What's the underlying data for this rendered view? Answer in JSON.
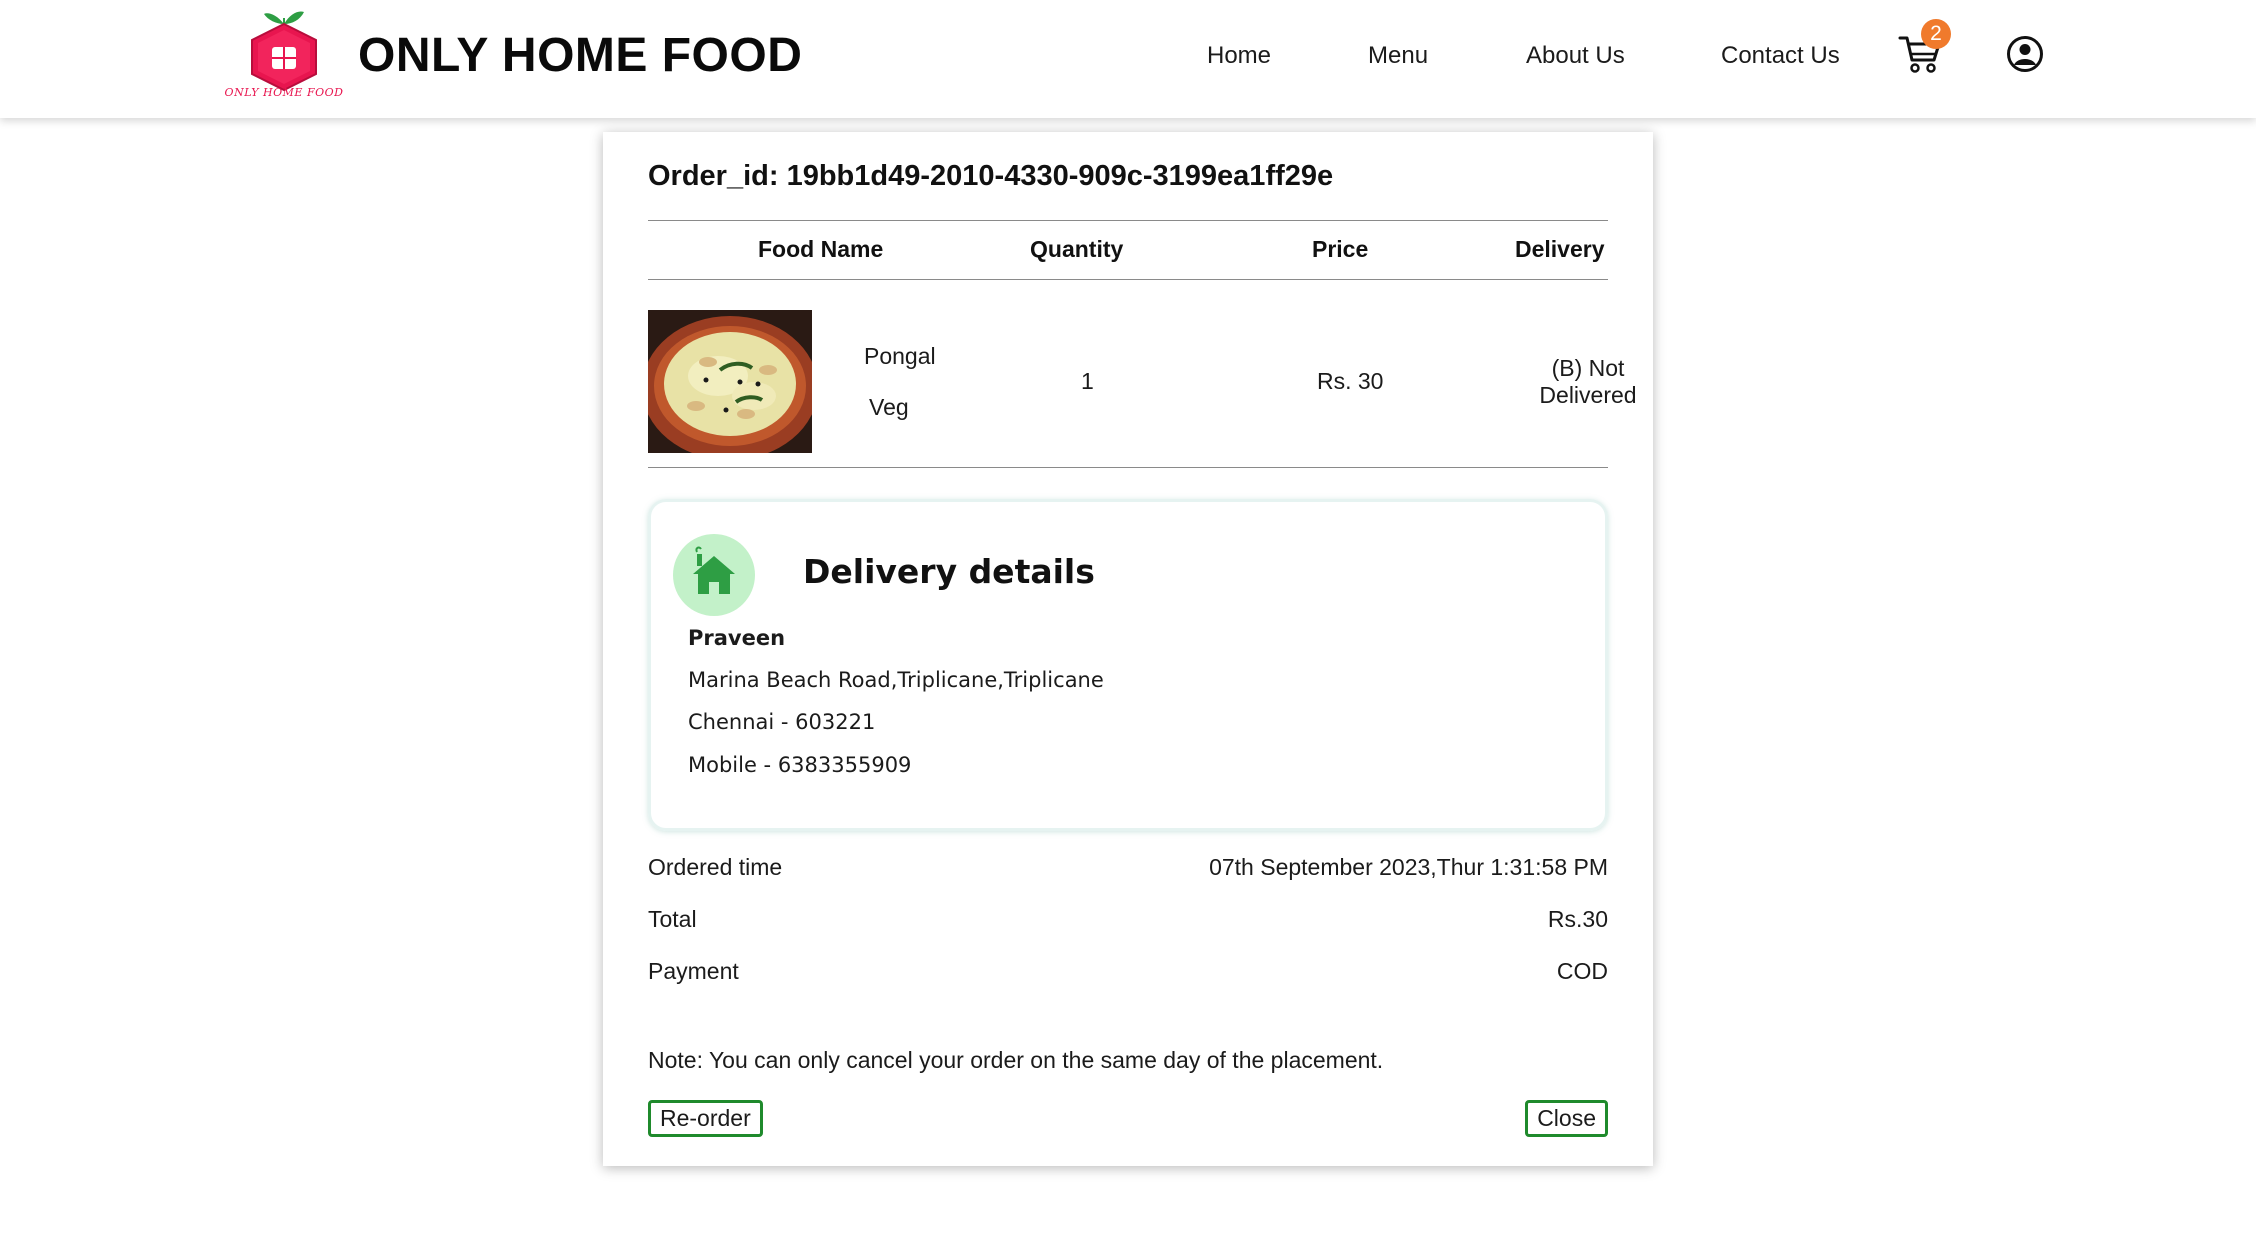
{
  "header": {
    "brand": "ONLY HOME FOOD",
    "logo_caption": "ONLY HOME FOOD",
    "nav": [
      {
        "label": "Home"
      },
      {
        "label": "Menu"
      },
      {
        "label": "About Us"
      },
      {
        "label": "Contact Us"
      }
    ],
    "cart_count": "2",
    "icons": {
      "cart": "cart-icon",
      "user": "user-circle-icon",
      "logo": "home-food-logo"
    }
  },
  "order": {
    "order_id_text": "Order_id: 19bb1d49-2010-4330-909c-3199ea1ff29e",
    "columns": [
      "Food Name",
      "Quantity",
      "Price",
      "Delivery"
    ],
    "items": [
      {
        "name": "Pongal",
        "type": "Veg",
        "quantity": "1",
        "price": "Rs. 30",
        "delivery_line1": "(B) Not",
        "delivery_line2": "Delivered"
      }
    ]
  },
  "delivery": {
    "title": "Delivery details",
    "name": "Praveen",
    "address_line": "Marina Beach Road,Triplicane,Triplicane",
    "city_line": "Chennai - 603221",
    "mobile_line": "Mobile - 6383355909"
  },
  "summary": {
    "ordered_time_label": "Ordered time",
    "ordered_time_value": "07th September 2023,Thur 1:31:58 PM",
    "total_label": "Total",
    "total_value": "Rs.30",
    "payment_label": "Payment",
    "payment_value": "COD"
  },
  "note": "Note: You can only cancel your order on the same day of the placement.",
  "buttons": {
    "reorder": "Re-order",
    "close": "Close"
  },
  "colors": {
    "logo_red": "#e8154f",
    "badge": "#f07a2c",
    "button_border": "#1f8a2c",
    "home_circle": "#c3f1c9",
    "home_icon": "#2e9e44"
  }
}
